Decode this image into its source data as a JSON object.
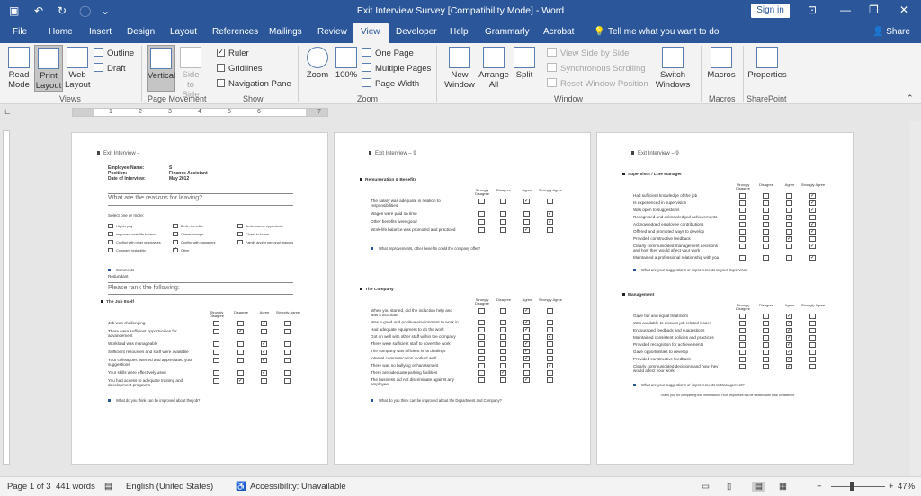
{
  "titlebar": {
    "title": "Exit Interview Survey [Compatibility Mode] - Word",
    "signin": "Sign in"
  },
  "tabs": [
    "File",
    "Home",
    "Insert",
    "Design",
    "Layout",
    "References",
    "Mailings",
    "Review",
    "View",
    "Developer",
    "Help",
    "Grammarly",
    "Acrobat",
    "Tell me what you want to do",
    "Share"
  ],
  "ribbon": {
    "views": {
      "read_mode": "Read Mode",
      "print_layout": "Print Layout",
      "web_layout": "Web Layout",
      "outline": "Outline",
      "draft": "Draft",
      "label": "Views"
    },
    "page_movement": {
      "vertical": "Vertical",
      "side_to_side": "Side to Side",
      "label": "Page Movement"
    },
    "show": {
      "ruler": "Ruler",
      "gridlines": "Gridlines",
      "navigation_pane": "Navigation Pane",
      "label": "Show"
    },
    "zoom": {
      "zoom": "Zoom",
      "hundred": "100%",
      "one_page": "One Page",
      "multiple_pages": "Multiple Pages",
      "page_width": "Page Width",
      "label": "Zoom"
    },
    "window": {
      "new_window": "New Window",
      "arrange_all": "Arrange All",
      "split": "Split",
      "view_side_by_side": "View Side by Side",
      "sync_scrolling": "Synchronous Scrolling",
      "reset_window": "Reset Window Position",
      "switch_windows": "Switch Windows",
      "label": "Window"
    },
    "macros": {
      "macros": "Macros",
      "label": "Macros"
    },
    "sharepoint": {
      "properties": "Properties",
      "label": "SharePoint"
    }
  },
  "ruler": {
    "marks": [
      "1",
      "2",
      "3",
      "4",
      "5",
      "6",
      "7"
    ]
  },
  "page1": {
    "header": "Exit Interview -",
    "fields": [
      [
        "Employee Name:",
        "S"
      ],
      [
        "Position:",
        "Finance Assistant"
      ],
      [
        "Date of Interview:",
        "May 2012"
      ]
    ],
    "q1": "What are the reasons for leaving?",
    "select_one": "Select one or more:",
    "options": [
      {
        "label": "Higher pay",
        "checked": false
      },
      {
        "label": "Better benefits",
        "checked": false
      },
      {
        "label": "Better career opportunity",
        "checked": false
      },
      {
        "label": "Improved work-life balance",
        "checked": false
      },
      {
        "label": "Career change",
        "checked": false
      },
      {
        "label": "Closer to home",
        "checked": false
      },
      {
        "label": "Conflict with other employees",
        "checked": false
      },
      {
        "label": "Conflict with managers",
        "checked": false
      },
      {
        "label": "Family and/or personal reasons",
        "checked": false
      },
      {
        "label": "Company instability",
        "checked": false
      },
      {
        "label": "Other",
        "checked": true
      }
    ],
    "comments": "Comments",
    "comments_value": "Redundant",
    "q2": "Please rank the following:",
    "section": "The Job Itself",
    "columns": [
      "Strongly Disagree",
      "Disagree",
      "Agree",
      "Strongly Agree"
    ],
    "rows": [
      {
        "text": "Job was challenging",
        "answer": 2
      },
      {
        "text": "There were sufficient opportunities for advancement",
        "answer": 1
      },
      {
        "text": "Workload was manageable",
        "answer": 2
      },
      {
        "text": "Sufficient resources and staff were available",
        "answer": 2
      },
      {
        "text": "Your colleagues listened and appreciated your suggestions",
        "answer": 2
      },
      {
        "text": "Your skills were effectively used",
        "answer": 2
      },
      {
        "text": "You had access to adequate training and development programs",
        "answer": 1
      }
    ],
    "bullet": "What do you think can be improved about the job?"
  },
  "page2": {
    "header": "Exit Interview – 9",
    "sec1": "Remuneration & Benefits",
    "columns": [
      "Strongly Disagree",
      "Disagree",
      "Agree",
      "Strongly Agree"
    ],
    "rows1": [
      {
        "text": "The salary was adequate in relation to responsibilities",
        "answer": 2
      },
      {
        "text": "Wages were paid on time",
        "answer": 3
      },
      {
        "text": "Other benefits were good",
        "answer": 3
      },
      {
        "text": "Work-life balance was promoted and practiced",
        "answer": 2
      }
    ],
    "bullet1": "What improvements, other benefits could the company offer?",
    "sec2": "The Company",
    "rows2": [
      {
        "text": "When you started, did the induction help and was it accurate",
        "answer": 2
      },
      {
        "text": "Was a good and positive environment to work in",
        "answer": 2
      },
      {
        "text": "Had adequate equipment to do the work",
        "answer": 2
      },
      {
        "text": "Got on well with other staff within the company",
        "answer": 3
      },
      {
        "text": "There were sufficient staff to cover the work",
        "answer": 2
      },
      {
        "text": "The company was efficient in its dealings",
        "answer": 2
      },
      {
        "text": "Internal communication worked well",
        "answer": 2
      },
      {
        "text": "There was no bullying or harassment",
        "answer": 3
      },
      {
        "text": "There are adequate parking facilities",
        "answer": 1
      },
      {
        "text": "The business did not discriminate against any employee",
        "answer": 2
      }
    ],
    "bullet2": "What do you think can be improved about the Department and Company?"
  },
  "page3": {
    "header": "Exit Interview – 9",
    "sec1": "Supervisor / Line Manager",
    "columns": [
      "Strongly Disagree",
      "Disagree",
      "Agree",
      "Strongly Agree"
    ],
    "rows1": [
      {
        "text": "Had sufficient knowledge of the job",
        "answer": 3
      },
      {
        "text": "Is experienced in supervision",
        "answer": 3
      },
      {
        "text": "Was open to suggestions",
        "answer": 3
      },
      {
        "text": "Recognised and acknowledged achievements",
        "answer": 2
      },
      {
        "text": "Acknowledged employee contributions",
        "answer": 3
      },
      {
        "text": "Offered and promoted ways to develop",
        "answer": 3
      },
      {
        "text": "Provided constructive feedback",
        "answer": 2
      },
      {
        "text": "Clearly communicated management decisions and how they would affect your work",
        "answer": 3
      },
      {
        "text": "Maintained a professional relationship with you",
        "answer": 3
      }
    ],
    "bullet1": "What are your suggestions or improvements to your Supervisor",
    "sec2": "Management",
    "rows2": [
      {
        "text": "Gave fair and equal treatment",
        "answer": 2
      },
      {
        "text": "Was available to discuss job related issues",
        "answer": 2
      },
      {
        "text": "Encouraged feedback and suggestions",
        "answer": 2
      },
      {
        "text": "Maintained consistent policies and practices",
        "answer": 2
      },
      {
        "text": "Provided recognition for achievements",
        "answer": 2
      },
      {
        "text": "Gave opportunities to develop",
        "answer": 2
      },
      {
        "text": "Provided constructive feedback",
        "answer": 2
      },
      {
        "text": "Clearly communicated decisions and how they would affect your work",
        "answer": 2
      }
    ],
    "bullet2": "What are your suggestions or improvements to Management?",
    "thanks": "Thank you for completing this information. Your responses will be treated with total confidence."
  },
  "status": {
    "page": "Page 1 of 3",
    "words": "441 words",
    "language": "English (United States)",
    "accessibility": "Accessibility: Unavailable",
    "zoom": "47%"
  }
}
